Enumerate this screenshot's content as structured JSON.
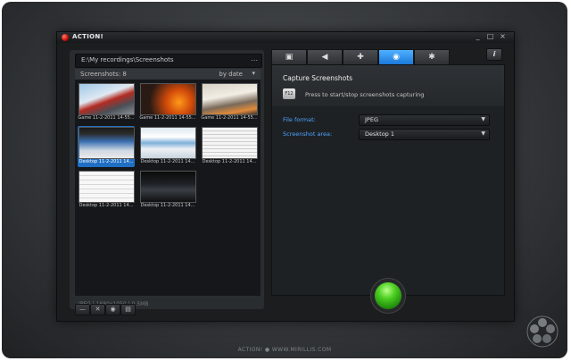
{
  "window": {
    "title": "ACTION!",
    "controls": [
      "_",
      "□",
      "×"
    ]
  },
  "left_panel": {
    "path": "E:\\My recordings\\Screenshots",
    "path_button": "...",
    "count_label": "Screenshots: 8",
    "sort_label": "by date",
    "thumbnails": [
      {
        "caption": "Game 11-2-2011 14-55..."
      },
      {
        "caption": "Game 11-2-2011 14-55..."
      },
      {
        "caption": "Game 11-2-2011 14-55..."
      },
      {
        "caption": "Desktop 11-2-2011 14..."
      },
      {
        "caption": "Desktop 11-2-2011 14..."
      },
      {
        "caption": "Desktop 11-2-2011 14..."
      },
      {
        "caption": "Desktop 11-2-2011 14..."
      },
      {
        "caption": "Desktop 11-2-2011 14..."
      }
    ],
    "status": "JPEG | 1680x1050 | 0.5MB",
    "buttons": {
      "minus": "—",
      "delete": "✕",
      "view": "◉",
      "folder": "▤"
    }
  },
  "tabs": [
    {
      "icon": "film-icon",
      "glyph": "▣"
    },
    {
      "icon": "speaker-icon",
      "glyph": "◀"
    },
    {
      "icon": "gamepad-icon",
      "glyph": "✚"
    },
    {
      "icon": "camera-icon",
      "glyph": "◉"
    },
    {
      "icon": "gear-icon",
      "glyph": "✱"
    }
  ],
  "info_button": "i",
  "capture": {
    "title": "Capture Screenshots",
    "hotkey": "F12",
    "hint": "Press to start/stop screenshots capturing"
  },
  "options": {
    "file_format_label": "File format:",
    "file_format_value": "JPEG",
    "area_label": "Screenshot area:",
    "area_value": "Desktop 1"
  },
  "footer": "ACTION!  ●  WWW.MIRILLIS.COM",
  "colors": {
    "accent": "#1f6fc4",
    "tab_active": "#2f8ef0",
    "go_button": "#3cc21a",
    "label_blue": "#4da3ff"
  }
}
